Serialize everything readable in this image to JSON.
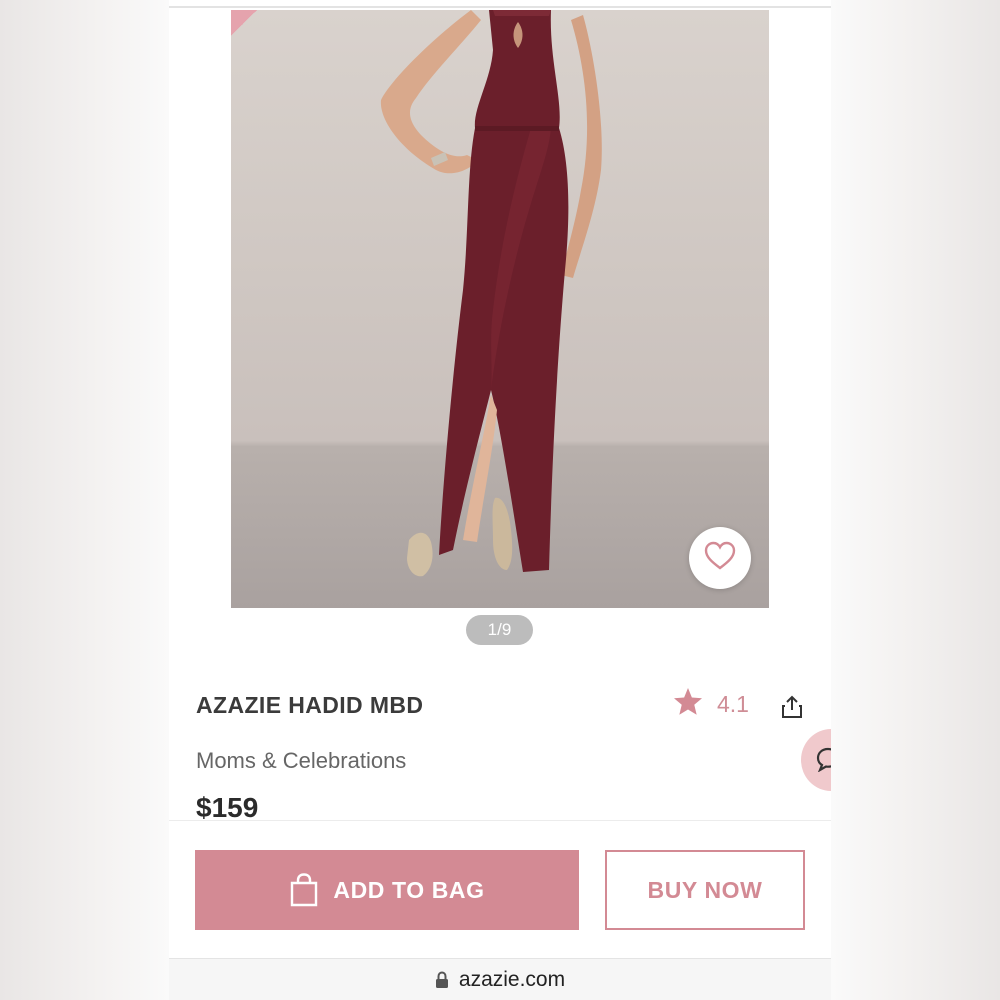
{
  "gallery": {
    "counter": "1/9",
    "favorite_icon": "heart-icon"
  },
  "product": {
    "title": "AZAZIE HADID MBD",
    "rating": "4.1",
    "category": "Moms & Celebrations",
    "price": "$159"
  },
  "actions": {
    "add_to_bag": "ADD TO BAG",
    "buy_now": "BUY NOW"
  },
  "browser": {
    "url": "azazie.com"
  },
  "colors": {
    "accent": "#d38a94",
    "rating_star": "#d38a94",
    "dress": "#6b1f2b"
  }
}
